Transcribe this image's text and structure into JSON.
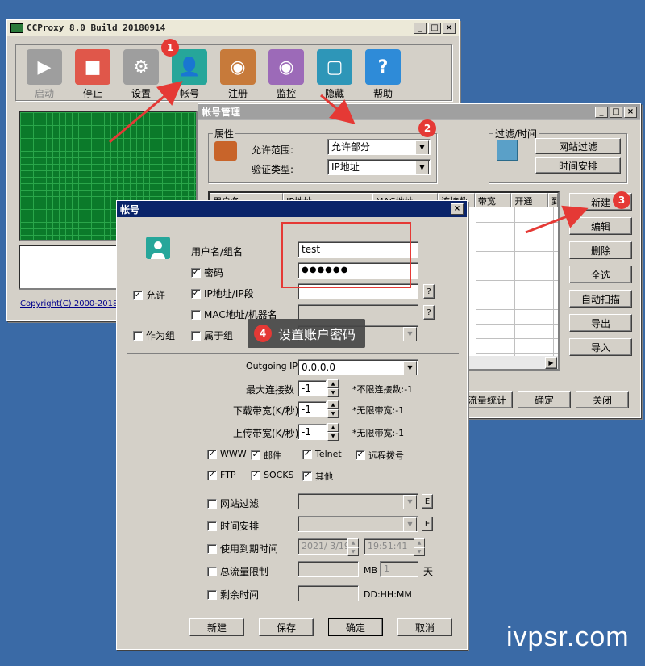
{
  "main_window": {
    "title": "CCProxy 8.0 Build 20180914",
    "toolbar": [
      {
        "label": "启动",
        "color": "#9e9e9e",
        "glyph": "▶",
        "icon": "play-icon",
        "disabled": true
      },
      {
        "label": "停止",
        "color": "#e0574a",
        "glyph": "■",
        "icon": "stop-icon"
      },
      {
        "label": "设置",
        "color": "#9e9e9e",
        "glyph": "⚙",
        "icon": "gear-icon"
      },
      {
        "label": "帐号",
        "color": "#26a69a",
        "glyph": "👤",
        "icon": "user-icon"
      },
      {
        "label": "注册",
        "color": "#c77a3a",
        "glyph": "◉",
        "icon": "globe-icon"
      },
      {
        "label": "监控",
        "color": "#9c6ab8",
        "glyph": "◉",
        "icon": "eye-icon"
      },
      {
        "label": "隐藏",
        "color": "#2e96b8",
        "glyph": "▢",
        "icon": "hide-icon"
      },
      {
        "label": "帮助",
        "color": "#2e8bd8",
        "glyph": "?",
        "icon": "help-icon"
      }
    ],
    "copyright": "Copyright(C) 2000-2018 Yo"
  },
  "account_manager": {
    "title": "帐号管理",
    "props_group": "属性",
    "allow_range_label": "允许范围:",
    "allow_range_value": "允许部分",
    "auth_type_label": "验证类型:",
    "auth_type_value": "IP地址",
    "filter_group": "过滤/时间",
    "website_filter_btn": "网站过滤",
    "time_schedule_btn": "时间安排",
    "columns": [
      "用户名",
      "IP地址",
      "MAC地址",
      "连接数",
      "带宽",
      "开通",
      "到"
    ],
    "side_buttons": [
      "新建",
      "编辑",
      "删除",
      "全选",
      "自动扫描",
      "导出",
      "导入"
    ],
    "bottom_buttons": [
      "流量统计",
      "确定",
      "关闭"
    ]
  },
  "account_dialog": {
    "title": "帐号",
    "username_label": "用户名/组名",
    "username_value": "test",
    "password_label": "密码",
    "password_value": "●●●●●●",
    "allow_label": "允许",
    "ip_label": "IP地址/IP段",
    "mac_label": "MAC地址/机器名",
    "as_group_label": "作为组",
    "belongs_group_label": "属于组",
    "tooltip": "设置账户密码",
    "outgoing_ip_label": "Outgoing IP",
    "outgoing_ip_value": "0.0.0.0",
    "max_conn_label": "最大连接数",
    "max_conn_value": "-1",
    "max_conn_hint": "*不限连接数:-1",
    "down_bw_label": "下载带宽(K/秒)",
    "down_bw_value": "-1",
    "down_bw_hint": "*无限带宽:-1",
    "up_bw_label": "上传带宽(K/秒)",
    "up_bw_value": "-1",
    "up_bw_hint": "*无限带宽:-1",
    "services": [
      "WWW",
      "邮件",
      "Telnet",
      "远程拨号",
      "FTP",
      "SOCKS",
      "其他"
    ],
    "website_filter_label": "网站过滤",
    "time_schedule_label": "时间安排",
    "expiry_label": "使用到期时间",
    "expiry_date": "2021/ 3/19",
    "expiry_time": "19:51:41",
    "traffic_limit_label": "总流量限制",
    "traffic_unit": "MB",
    "days_value": "1",
    "days_unit": "天",
    "remaining_label": "剩余时间",
    "remaining_format": "DD:HH:MM",
    "e_btn": "E",
    "q_btn": "?",
    "buttons": [
      "新建",
      "保存",
      "确定",
      "取消"
    ]
  },
  "annotations": [
    "1",
    "2",
    "3",
    "4"
  ],
  "watermark": "ivpsr.com",
  "accent": "#e53935"
}
